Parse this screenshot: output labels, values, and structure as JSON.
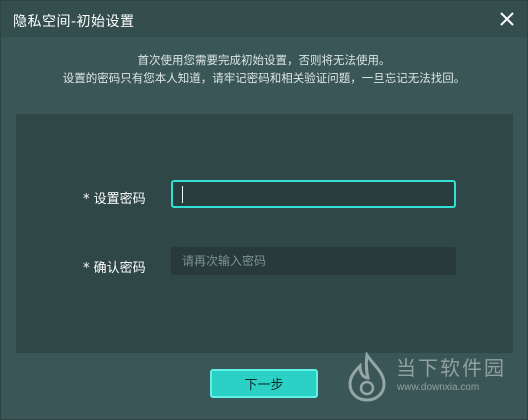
{
  "window": {
    "title": "隐私空间-初始设置"
  },
  "intro": {
    "line1": "首次使用您需要完成初始设置，否则将无法使用。",
    "line2": "设置的密码只有您本人知道，请牢记密码和相关验证问题，一旦忘记无法找回。"
  },
  "form": {
    "password_label": "* 设置密码",
    "password_value": "",
    "confirm_label": "* 确认密码",
    "confirm_placeholder": "请再次输入密码",
    "confirm_value": ""
  },
  "actions": {
    "next_label": "下一步"
  },
  "watermark": {
    "brand": "当下软件园",
    "url": "www.downxia.com"
  },
  "colors": {
    "background": "#3b5656",
    "panel": "#2f4747",
    "accent": "#2ad1c4"
  },
  "icons": {
    "close": "close-icon",
    "watermark_logo": "flame-logo-icon"
  }
}
